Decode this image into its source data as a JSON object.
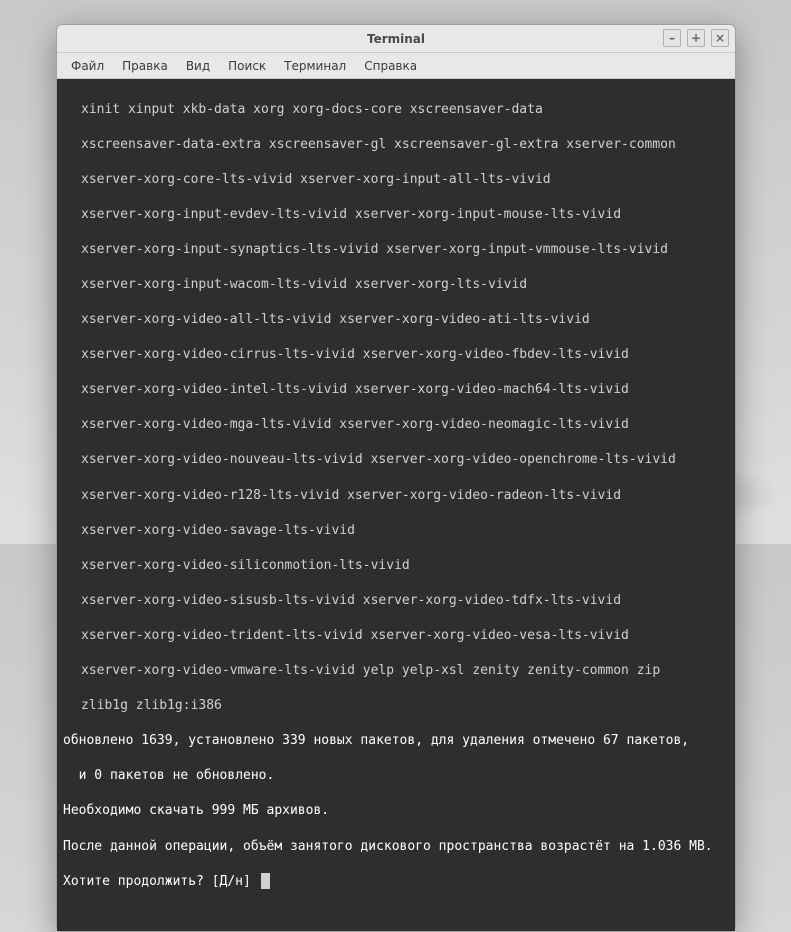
{
  "window": {
    "title": "Terminal",
    "controls": {
      "min": "–",
      "max": "+",
      "close": "×"
    }
  },
  "menu": {
    "file": "Файл",
    "edit": "Правка",
    "view": "Вид",
    "search": "Поиск",
    "terminal": "Терминал",
    "help": "Справка"
  },
  "packages": [
    "xinit xinput xkb-data xorg xorg-docs-core xscreensaver-data",
    "xscreensaver-data-extra xscreensaver-gl xscreensaver-gl-extra xserver-common",
    "xserver-xorg-core-lts-vivid xserver-xorg-input-all-lts-vivid",
    "xserver-xorg-input-evdev-lts-vivid xserver-xorg-input-mouse-lts-vivid",
    "xserver-xorg-input-synaptics-lts-vivid xserver-xorg-input-vmmouse-lts-vivid",
    "xserver-xorg-input-wacom-lts-vivid xserver-xorg-lts-vivid",
    "xserver-xorg-video-all-lts-vivid xserver-xorg-video-ati-lts-vivid",
    "xserver-xorg-video-cirrus-lts-vivid xserver-xorg-video-fbdev-lts-vivid",
    "xserver-xorg-video-intel-lts-vivid xserver-xorg-video-mach64-lts-vivid",
    "xserver-xorg-video-mga-lts-vivid xserver-xorg-video-neomagic-lts-vivid",
    "xserver-xorg-video-nouveau-lts-vivid xserver-xorg-video-openchrome-lts-vivid",
    "xserver-xorg-video-r128-lts-vivid xserver-xorg-video-radeon-lts-vivid",
    "xserver-xorg-video-savage-lts-vivid",
    "xserver-xorg-video-siliconmotion-lts-vivid",
    "xserver-xorg-video-sisusb-lts-vivid xserver-xorg-video-tdfx-lts-vivid",
    "xserver-xorg-video-trident-lts-vivid xserver-xorg-video-vesa-lts-vivid",
    "xserver-xorg-video-vmware-lts-vivid yelp yelp-xsl zenity zenity-common zip",
    "zlib1g zlib1g:i386"
  ],
  "summary": {
    "line1": "обновлено 1639, установлено 339 новых пакетов, для удаления отмечено 67 пакетов,",
    "line1b": "  и 0 пакетов не обновлено.",
    "line2": "Необходимо скачать 999 MБ архивов.",
    "line3": "После данной операции, объём занятого дискового пространства возрастёт на 1.036 MB.",
    "prompt": "Хотите продолжить? [Д/н] "
  }
}
